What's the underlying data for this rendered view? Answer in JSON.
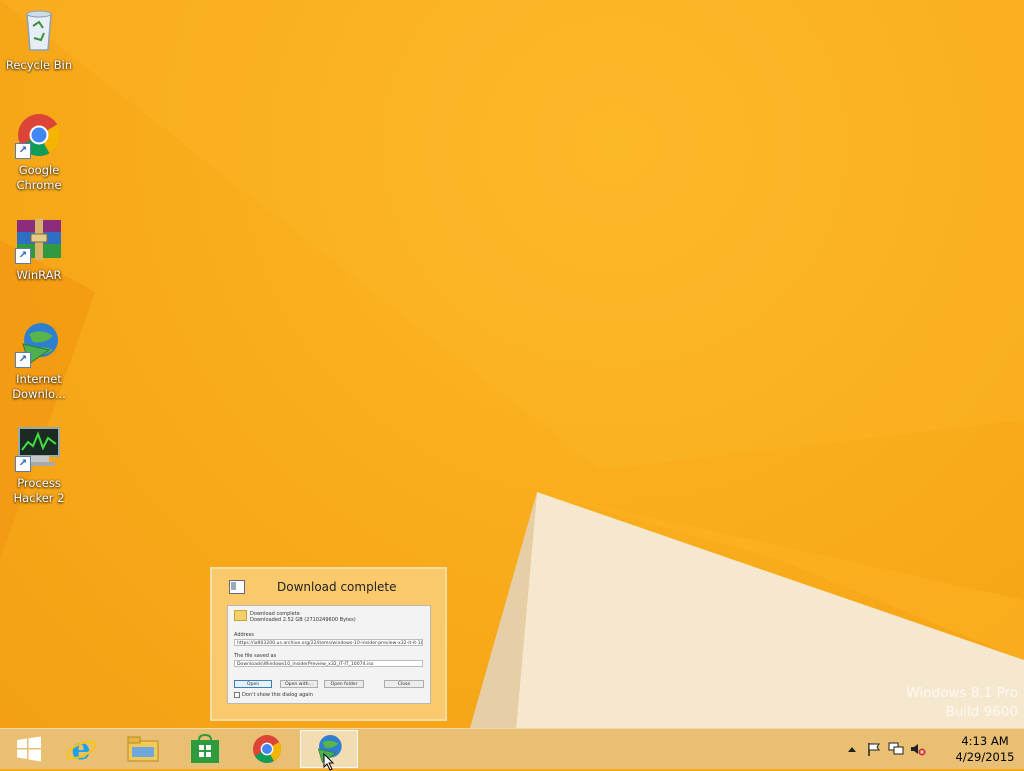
{
  "desktop": {
    "icons": [
      {
        "label": "Recycle Bin",
        "icon": "recycle-bin-icon",
        "shortcut": false
      },
      {
        "label": "Google Chrome",
        "icon": "chrome-icon",
        "shortcut": true
      },
      {
        "label": "WinRAR",
        "icon": "winrar-icon",
        "shortcut": true
      },
      {
        "label": "Internet Downlo...",
        "icon": "internet-download-manager-icon",
        "shortcut": true
      },
      {
        "label": "Process Hacker 2",
        "icon": "process-hacker-icon",
        "shortcut": true
      }
    ],
    "watermark": {
      "line1": "Windows 8.1 Pro",
      "line2": "Build 9600"
    }
  },
  "preview": {
    "title": "Download complete",
    "dialog": {
      "heading": "Download complete",
      "downloaded": "Downloaded 2.52 GB (2710249600 Bytes)",
      "address_label": "Address",
      "address_value": "https://ia903200.us.archive.org/22/items/windows-10-insider-preview-x32-it-it-10074/...",
      "saved_label": "The file saved as",
      "saved_value": "Downloads\\Windows10_InsiderPreview_x32_IT-IT_10074.iso",
      "buttons": [
        "Open",
        "Open with...",
        "Open folder",
        "Close"
      ],
      "checkbox_label": "Don't show this dialog again"
    }
  },
  "taskbar": {
    "apps": [
      {
        "name": "start",
        "icon": "windows-start-icon"
      },
      {
        "name": "internet-explorer",
        "icon": "internet-explorer-icon"
      },
      {
        "name": "file-explorer",
        "icon": "file-explorer-icon"
      },
      {
        "name": "store",
        "icon": "store-icon"
      },
      {
        "name": "chrome",
        "icon": "chrome-icon"
      },
      {
        "name": "internet-download-manager",
        "icon": "internet-download-manager-icon",
        "active": true
      }
    ],
    "tray": {
      "time": "4:13 AM",
      "date": "4/29/2015"
    }
  },
  "colors": {
    "wallpaper": "#f9ad1c",
    "taskbar": "#e8bf73",
    "preview": "#f9c96c"
  }
}
